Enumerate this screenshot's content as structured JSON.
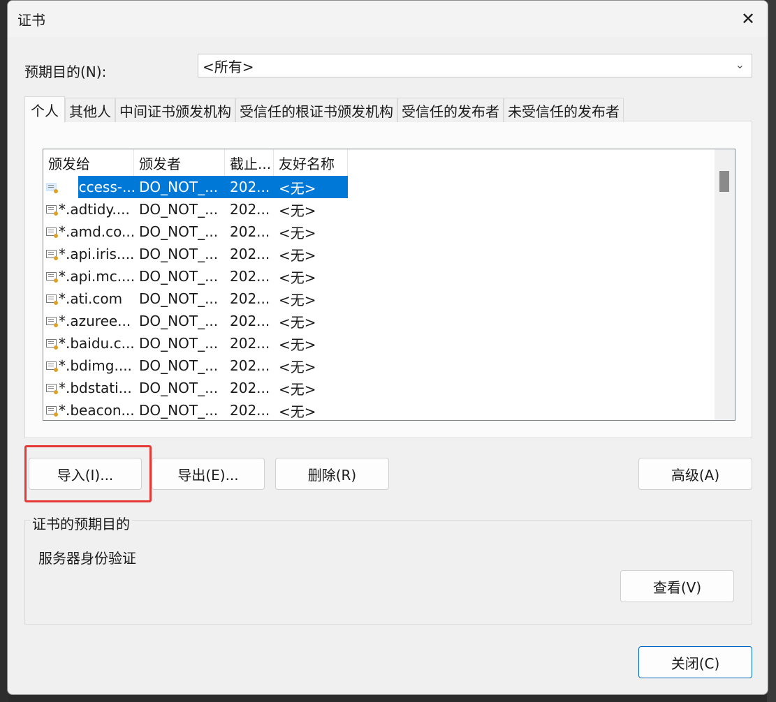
{
  "window": {
    "title": "证书",
    "close_glyph": "✕"
  },
  "purpose": {
    "label": "预期目的(N):",
    "value": "<所有>"
  },
  "tabs": [
    {
      "label": "个人",
      "active": true
    },
    {
      "label": "其他人",
      "active": false
    },
    {
      "label": "中间证书颁发机构",
      "active": false
    },
    {
      "label": "受信任的根证书颁发机构",
      "active": false
    },
    {
      "label": "受信任的发布者",
      "active": false
    },
    {
      "label": "未受信任的发布者",
      "active": false
    }
  ],
  "list": {
    "columns": [
      "颁发给",
      "颁发者",
      "截止...",
      "友好名称"
    ],
    "rows": [
      {
        "issued_to": "*.access-...",
        "issuer": "DO_NOT_...",
        "expires": "202...",
        "friendly": "<无>",
        "selected": true
      },
      {
        "issued_to": "*.adtidy....",
        "issuer": "DO_NOT_...",
        "expires": "202...",
        "friendly": "<无>"
      },
      {
        "issued_to": "*.amd.co...",
        "issuer": "DO_NOT_...",
        "expires": "202...",
        "friendly": "<无>"
      },
      {
        "issued_to": "*.api.iris....",
        "issuer": "DO_NOT_...",
        "expires": "202...",
        "friendly": "<无>"
      },
      {
        "issued_to": "*.api.mc....",
        "issuer": "DO_NOT_...",
        "expires": "202...",
        "friendly": "<无>"
      },
      {
        "issued_to": "*.ati.com",
        "issuer": "DO_NOT_...",
        "expires": "202...",
        "friendly": "<无>"
      },
      {
        "issued_to": "*.azuree...",
        "issuer": "DO_NOT_...",
        "expires": "202...",
        "friendly": "<无>"
      },
      {
        "issued_to": "*.baidu.c...",
        "issuer": "DO_NOT_...",
        "expires": "202...",
        "friendly": "<无>"
      },
      {
        "issued_to": "*.bdimg....",
        "issuer": "DO_NOT_...",
        "expires": "202...",
        "friendly": "<无>"
      },
      {
        "issued_to": "*.bdstati...",
        "issuer": "DO_NOT_...",
        "expires": "202...",
        "friendly": "<无>"
      },
      {
        "issued_to": "*.beacon...",
        "issuer": "DO_NOT_...",
        "expires": "202...",
        "friendly": "<无>"
      }
    ]
  },
  "buttons": {
    "import": "导入(I)...",
    "export": "导出(E)...",
    "delete": "删除(R)",
    "advanced": "高级(A)",
    "view": "查看(V)",
    "close": "关闭(C)"
  },
  "purpose_group": {
    "title": "证书的预期目的",
    "value": "服务器身份验证"
  },
  "colors": {
    "selection": "#0078d7",
    "highlight_box": "#e53935"
  }
}
